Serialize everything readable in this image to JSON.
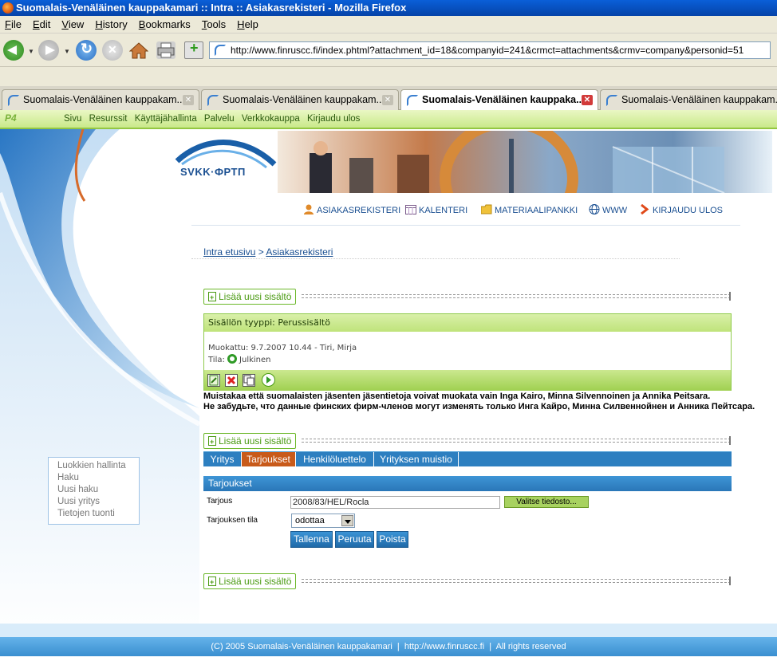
{
  "window": {
    "title": "Suomalais-Venäläinen kauppakamari :: Intra :: Asiakasrekisteri - Mozilla Firefox"
  },
  "menu": {
    "items": [
      "File",
      "Edit",
      "View",
      "History",
      "Bookmarks",
      "Tools",
      "Help"
    ],
    "underlines": [
      "F",
      "E",
      "V",
      "H",
      "B",
      "T",
      "H"
    ]
  },
  "toolbar": {
    "url": "http://www.finruscc.fi/index.phtml?attachment_id=18&companyid=241&crmct=attachments&crmv=company&personid=51"
  },
  "tabs": [
    {
      "label": "Suomalais-Venäläinen kauppakam...",
      "active": false
    },
    {
      "label": "Suomalais-Venäläinen kauppakam...",
      "active": false
    },
    {
      "label": "Suomalais-Venäläinen kauppaka...",
      "active": true
    },
    {
      "label": "Suomalais-Venäläinen kauppakam...",
      "active": false
    }
  ],
  "sitebar": {
    "brand": "P4",
    "items": [
      "Sivu",
      "Resurssit",
      "Käyttäjähallinta",
      "Palvelu",
      "Verkkokauppa",
      "Kirjaudu ulos"
    ]
  },
  "header": {
    "logo_text": "SVKK·ФРТП",
    "nav": [
      {
        "label": "ASIAKASREKISTERI",
        "icon": "person-icon"
      },
      {
        "label": "KALENTERI",
        "icon": "calendar-icon"
      },
      {
        "label": "MATERIAALIPANKKI",
        "icon": "folder-icon"
      },
      {
        "label": "WWW",
        "icon": "globe-icon"
      },
      {
        "label": "KIRJAUDU ULOS",
        "icon": "chevron-right-icon"
      }
    ]
  },
  "breadcrumb": {
    "home": "Intra etusivu",
    "sep": " > ",
    "current": "Asiakasrekisteri"
  },
  "add_content_label": "Lisää uusi sisältö",
  "content_box": {
    "type_label": "Sisällön tyyppi: Perussisältö",
    "modified": "Muokattu: 9.7.2007 10.44 - Tiri, Mirja",
    "state_label": "Tila:",
    "state_value": "Julkinen"
  },
  "notice": {
    "fi": "Muistakaa että suomalaisten jäsenten jäsentietoja voivat muokata vain Inga Kairo, Minna Silvennoinen ja Annika Peitsara.",
    "ru": "Не забудьте, что данные финских фирм-членов могут изменять только Инга Кайро, Минна Силвеннойнен и Анника Пейтсара."
  },
  "content_tabs": [
    {
      "label": "Yritys",
      "active": false
    },
    {
      "label": "Tarjoukset",
      "active": true
    },
    {
      "label": "Henkilöluettelo",
      "active": false
    },
    {
      "label": "Yrityksen muistio",
      "active": false
    }
  ],
  "form": {
    "title": "Tarjoukset",
    "tarjous_label": "Tarjous",
    "tarjous_value": "2008/83/HEL/Rocla",
    "browse_label": "Valitse tiedosto...",
    "state_label": "Tarjouksen tila",
    "state_value": "odottaa",
    "buttons": {
      "save": "Tallenna",
      "cancel": "Peruuta",
      "delete": "Poista"
    }
  },
  "left_menu": [
    "Luokkien hallinta",
    "Haku",
    "Uusi haku",
    "Uusi yritys",
    "Tietojen tuonti"
  ],
  "footer": {
    "text": "(C) 2005 Suomalais-Venäläinen kauppakamari  |  http://www.finruscc.fi  |  All rights reserved"
  },
  "colors": {
    "accent_green": "#93c741",
    "accent_blue": "#2d7fc0",
    "active_tab": "#c85a1a",
    "title_bar": "#0a5fd8"
  }
}
